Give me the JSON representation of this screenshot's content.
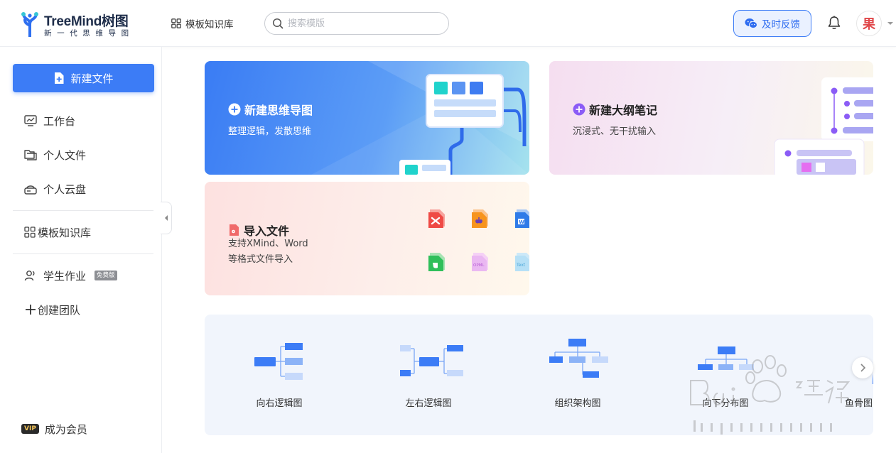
{
  "header": {
    "brand_name": "TreeMind树图",
    "brand_tagline": "新一代思维导图",
    "templates_nav": "模板知识库",
    "search_placeholder": "搜索模版",
    "feedback_label": "及时反馈",
    "avatar_char": "果"
  },
  "sidebar": {
    "new_file_label": "新建文件",
    "items": [
      {
        "label": "工作台",
        "icon": "dashboard-icon"
      },
      {
        "label": "个人文件",
        "icon": "folder-icon"
      },
      {
        "label": "个人云盘",
        "icon": "cloud-drive-icon"
      },
      {
        "label": "模板知识库",
        "icon": "grid-icon"
      },
      {
        "label": "学生作业",
        "icon": "student-icon",
        "badge": "免费版"
      },
      {
        "label": "创建团队",
        "icon": "plus-icon"
      }
    ],
    "vip_badge": "VIP",
    "membership_label": "成为会员"
  },
  "cards": {
    "mindmap": {
      "title": "新建思维导图",
      "desc": "整理逻辑，发散思维"
    },
    "outline": {
      "title": "新建大纲笔记",
      "desc": "沉浸式、无干扰输入"
    },
    "import": {
      "title": "导入文件",
      "desc_line1": "支持XMind、Word",
      "desc_line2": "等格式文件导入",
      "formats": [
        "XMind",
        "MindManager",
        "Word",
        "Evernote",
        "OPML",
        "Text"
      ]
    }
  },
  "templates": [
    {
      "label": "向右逻辑图"
    },
    {
      "label": "左右逻辑图"
    },
    {
      "label": "组织架构图"
    },
    {
      "label": "向下分布图"
    },
    {
      "label": "鱼骨图"
    }
  ],
  "colors": {
    "accent": "#3c7cf6",
    "brand_dark": "#1e2d4a",
    "purple": "#8b5cf6"
  }
}
